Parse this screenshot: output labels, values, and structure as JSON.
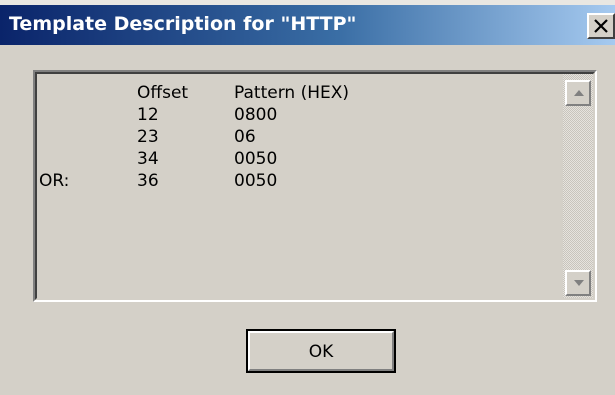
{
  "window": {
    "title": "Template Description for \"HTTP\"",
    "close_icon": "close-icon",
    "titlebar_color_start": "#0a246a",
    "titlebar_color_end": "#a6caf0",
    "face_color": "#d4d0c8"
  },
  "listbox": {
    "header": {
      "prefix": "",
      "offset": "Offset",
      "pattern": "Pattern (HEX)"
    },
    "rows": [
      {
        "prefix": "",
        "offset": "12",
        "pattern": "0800"
      },
      {
        "prefix": "",
        "offset": "23",
        "pattern": "06"
      },
      {
        "prefix": "",
        "offset": "34",
        "pattern": "0050"
      },
      {
        "prefix": "OR:",
        "offset": "36",
        "pattern": "0050"
      }
    ],
    "scroll_up_icon": "arrow-up-icon",
    "scroll_down_icon": "arrow-down-icon"
  },
  "buttons": {
    "ok_label": "OK"
  }
}
